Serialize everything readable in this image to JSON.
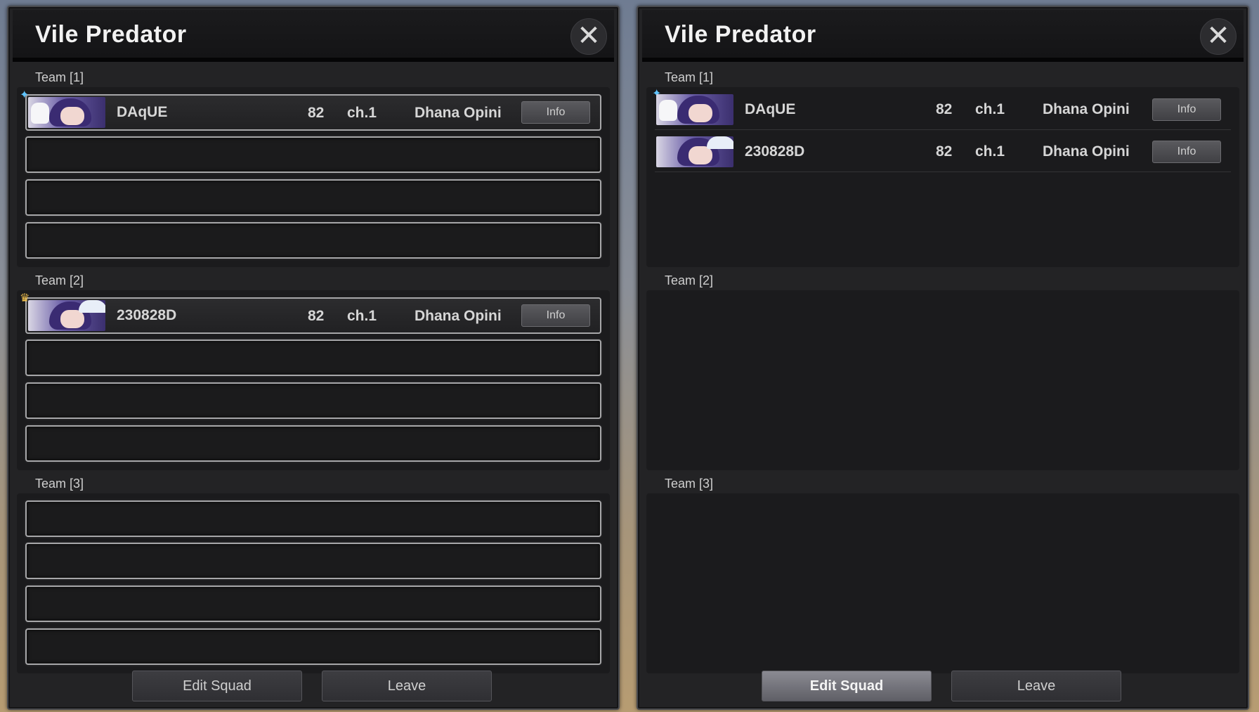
{
  "colors": {
    "panel_bg": "#232325",
    "titlebar": "#141416",
    "slot_border": "#a7a7a9",
    "text": "#d6d6d6"
  },
  "panels": [
    {
      "title": "Vile Predator",
      "close_icon": "close-icon",
      "teams": [
        {
          "label": "Team [1]",
          "members": [
            {
              "name": "DAqUE",
              "level": "82",
              "channel": "ch.1",
              "server": "Dhana Opini",
              "info": "Info",
              "badge_icon": "star-icon"
            }
          ]
        },
        {
          "label": "Team [2]",
          "members": [
            {
              "name": "230828D",
              "level": "82",
              "channel": "ch.1",
              "server": "Dhana Opini",
              "info": "Info",
              "badge_icon": "crown-icon"
            }
          ]
        },
        {
          "label": "Team [3]",
          "members": []
        }
      ],
      "buttons": {
        "edit": "Edit Squad",
        "leave": "Leave"
      }
    },
    {
      "title": "Vile Predator",
      "close_icon": "close-icon",
      "teams": [
        {
          "label": "Team [1]",
          "members": [
            {
              "name": "DAqUE",
              "level": "82",
              "channel": "ch.1",
              "server": "Dhana Opini",
              "info": "Info",
              "badge_icon": "star-icon"
            },
            {
              "name": "230828D",
              "level": "82",
              "channel": "ch.1",
              "server": "Dhana Opini",
              "info": "Info"
            }
          ]
        },
        {
          "label": "Team [2]",
          "members": []
        },
        {
          "label": "Team [3]",
          "members": []
        }
      ],
      "buttons": {
        "edit": "Edit Squad",
        "leave": "Leave"
      }
    }
  ]
}
